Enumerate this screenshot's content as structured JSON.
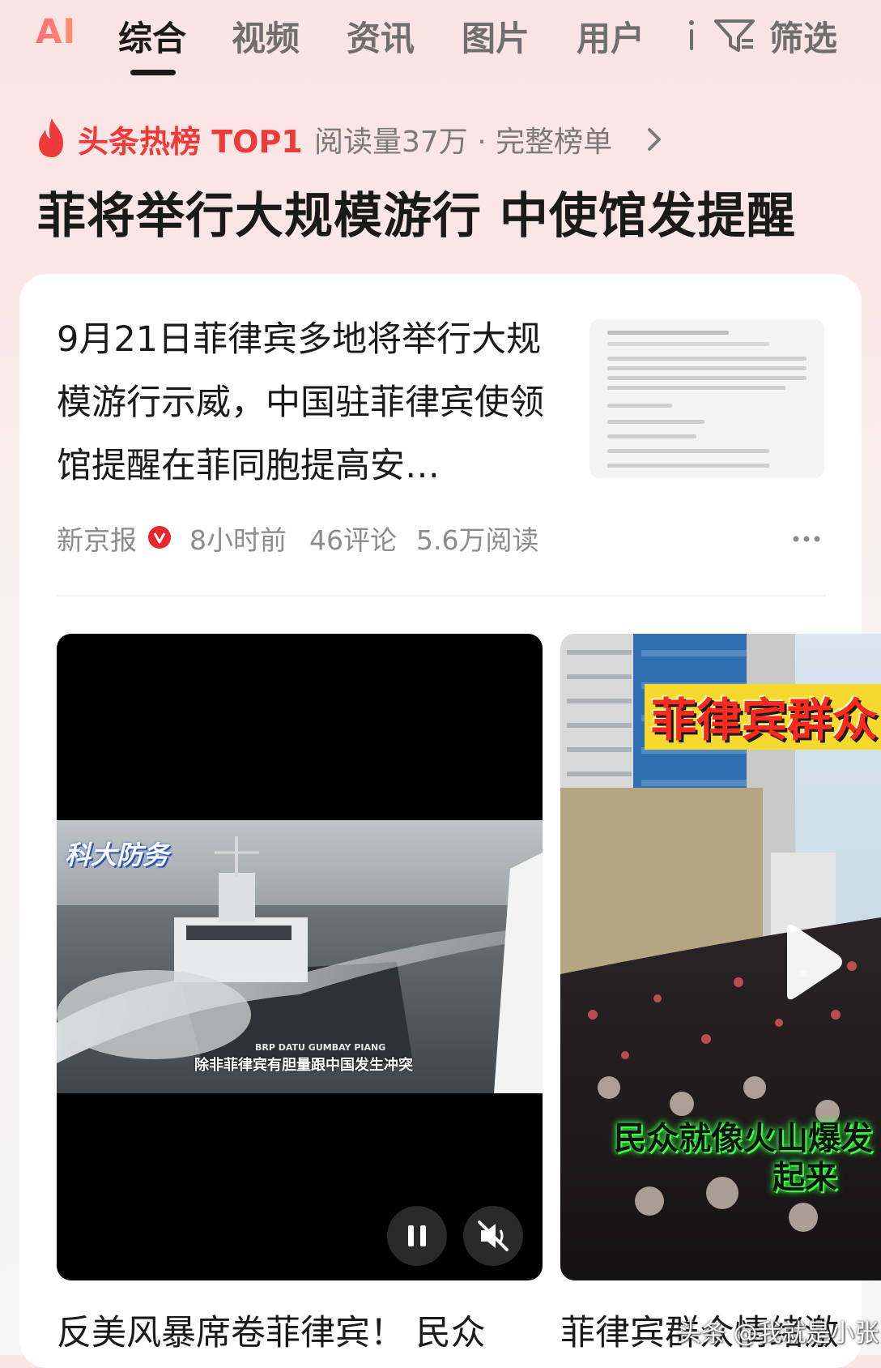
{
  "tabs": {
    "ai_label": "AI",
    "items": [
      "综合",
      "视频",
      "资讯",
      "图片",
      "用户"
    ],
    "filter_label": "筛选"
  },
  "hot": {
    "label": "头条热榜 TOP1",
    "meta": "阅读量37万 · 完整榜单",
    "headline": "菲将举行大规模游行 中使馆发提醒"
  },
  "article": {
    "title": "9月21日菲律宾多地将举行大规模游行示威，中国驻菲律宾使领馆提醒在菲同胞提高安…",
    "source": "新京报",
    "time": "8小时前",
    "comments": "46评论",
    "reads": "5.6万阅读"
  },
  "video_main": {
    "logo_text": "科大防务",
    "subtitle": "除非菲律宾有胆量跟中国发生冲突",
    "ship_name": "BRP DATU GUMBAY PIANG",
    "title": "反美风暴席卷菲律宾！ 民众"
  },
  "video_side": {
    "top_text": "菲律宾群众",
    "caption_1": "民众就像火山爆发",
    "caption_2": "起来",
    "title": "菲律宾群众情绪激"
  },
  "watermark": "头条 @我就是小张",
  "colors": {
    "accent_red": "#ef3a3a",
    "verified_red": "#e8262c",
    "ai_gradient_start": "#ff6f7a",
    "ai_gradient_end": "#ff8f6b"
  }
}
